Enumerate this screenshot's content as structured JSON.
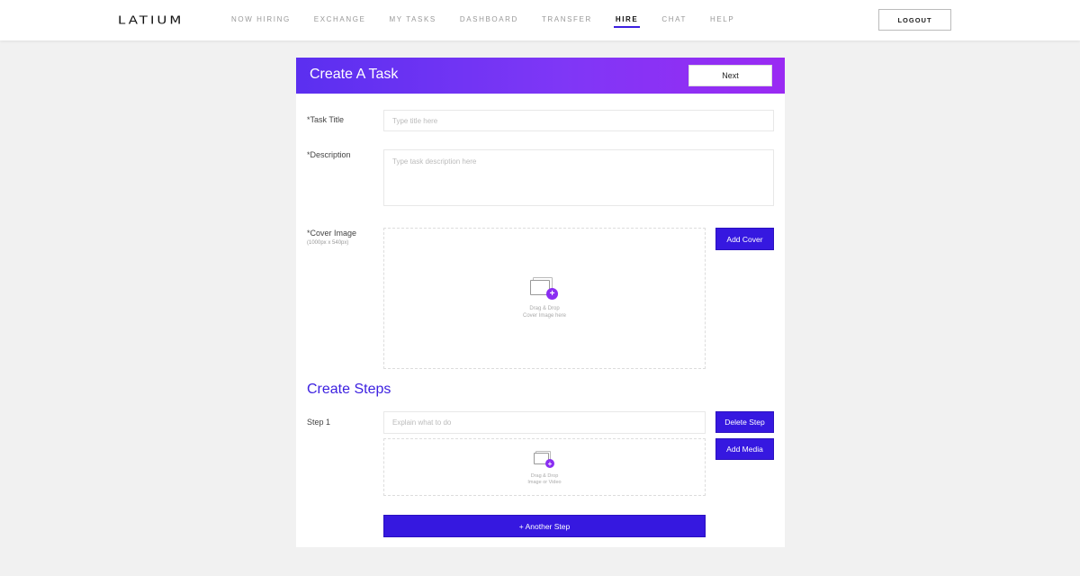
{
  "app": {
    "logo": "LATIUM"
  },
  "nav": {
    "items": [
      {
        "label": "NOW HIRING",
        "active": false
      },
      {
        "label": "EXCHANGE",
        "active": false
      },
      {
        "label": "MY TASKS",
        "active": false
      },
      {
        "label": "DASHBOARD",
        "active": false
      },
      {
        "label": "TRANSFER",
        "active": false
      },
      {
        "label": "HIRE",
        "active": true
      },
      {
        "label": "CHAT",
        "active": false
      },
      {
        "label": "HELP",
        "active": false
      }
    ],
    "logout_label": "LOGOUT"
  },
  "form": {
    "title": "Create A Task",
    "next_label": "Next",
    "task_title": {
      "label": "*Task Title",
      "placeholder": "Type title here",
      "value": ""
    },
    "description": {
      "label": "*Description",
      "placeholder": "Type task description here",
      "value": ""
    },
    "cover_image": {
      "label": "*Cover Image",
      "hint": "(1000px x 540px)",
      "drop_line1": "Drag & Drop",
      "drop_line2": "Cover Image here",
      "add_label": "Add Cover"
    },
    "steps": {
      "title": "Create Steps",
      "items": [
        {
          "label": "Step 1",
          "placeholder": "Explain what to do",
          "value": "",
          "drop_line1": "Drag & Drop",
          "drop_line2": "Image or Video",
          "delete_label": "Delete Step",
          "media_label": "Add Media"
        }
      ],
      "another_label": "+ Another Step"
    }
  },
  "colors": {
    "accent": "#3618e0",
    "header_gradient_start": "#5b2ff0",
    "header_gradient_end": "#9a2af3",
    "plus_badge": "#8a2df2"
  }
}
